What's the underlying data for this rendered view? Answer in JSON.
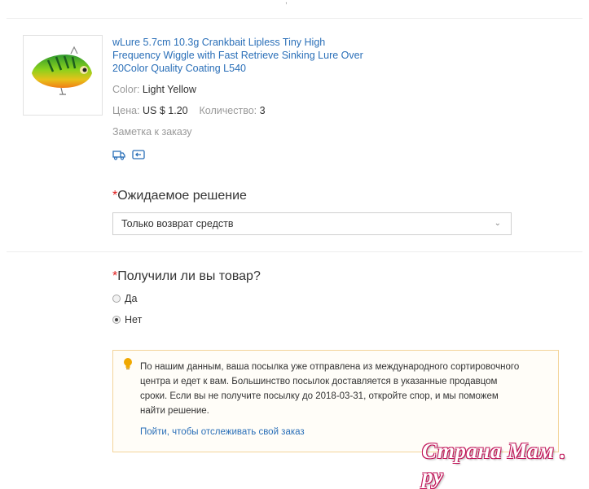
{
  "product": {
    "title": "wLure 5.7cm 10.3g Crankbait Lipless Tiny High Frequency Wiggle with Fast Retrieve Sinking Lure Over 20Color Quality Coating L540",
    "color_label": "Color:",
    "color_value": "Light Yellow",
    "price_label": "Цена:",
    "price_value": "US $ 1.20",
    "qty_label": "Количество:",
    "qty_value": "3",
    "note_label": "Заметка к заказу",
    "icons": [
      "shipping-truck-icon",
      "return-icon"
    ]
  },
  "resolution": {
    "required_mark": "*",
    "label": "Ожидаемое решение",
    "selected": "Только возврат средств"
  },
  "received": {
    "required_mark": "*",
    "label": "Получили ли вы товар?",
    "options": [
      {
        "label": "Да",
        "checked": false
      },
      {
        "label": "Нет",
        "checked": true
      }
    ]
  },
  "notice": {
    "icon": "lightbulb-icon",
    "text": "По нашим данным, ваша посылка уже отправлена из международного сортировочного центра и едет к вам. Большинство посылок доставляется в указанные продавцом сроки. Если вы не получите посылку до 2018-03-31, откройте спор, и мы поможем найти решение.",
    "link": "Пойти, чтобы отслеживать свой заказ"
  },
  "watermark": "Страна Мам . ру",
  "colors": {
    "link": "#2a6fb8",
    "required": "#e02020",
    "notice_border": "#f3d49a",
    "bulb": "#f0a800"
  }
}
